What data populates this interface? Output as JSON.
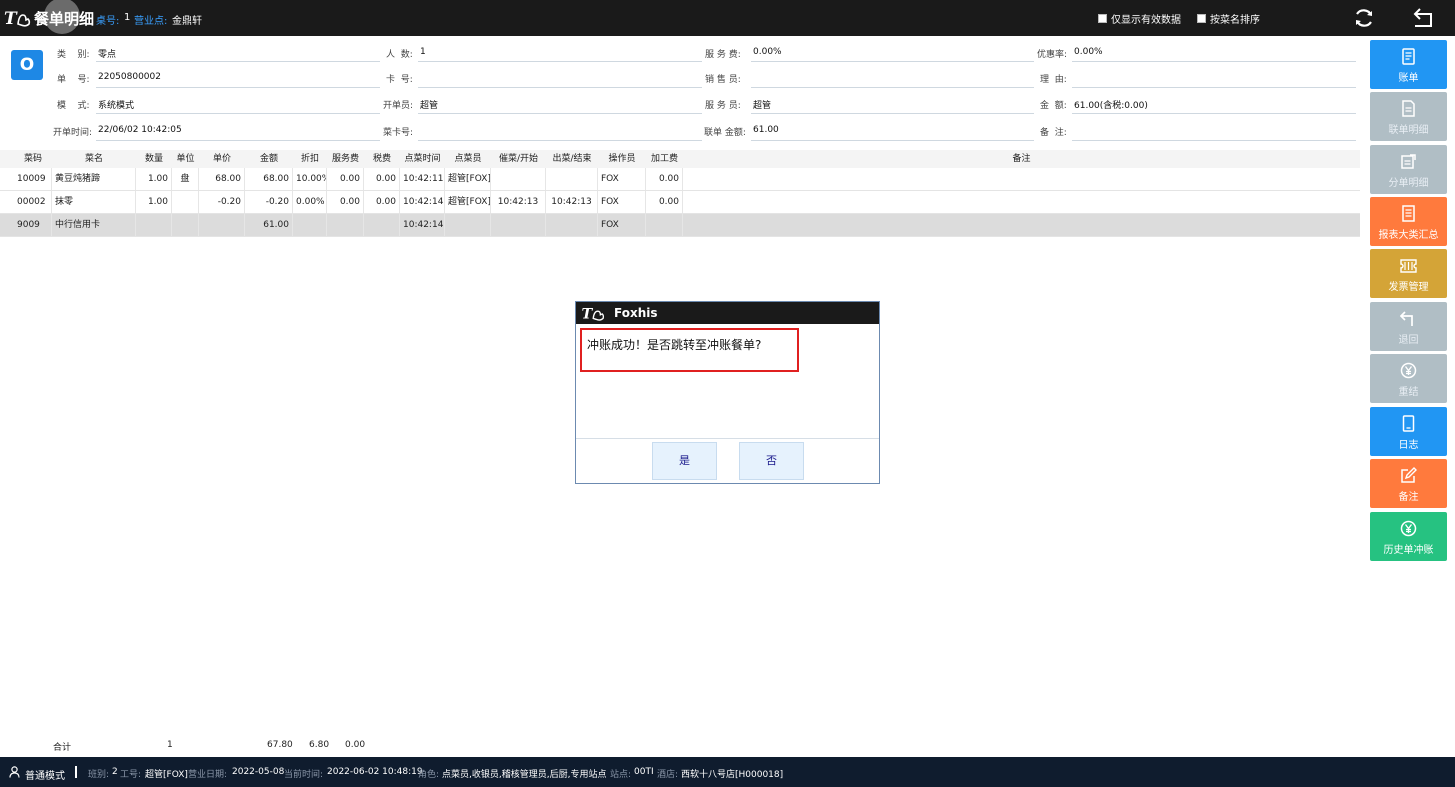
{
  "header": {
    "title": "餐单明细",
    "table_label": "桌号:",
    "table_value": "1",
    "outlet_label": "营业点:",
    "outlet_value": "金鼎轩",
    "opt_valid_only": "仅显示有效数据",
    "opt_sort_by_name": "按菜名排序"
  },
  "info": {
    "avatar": "O",
    "type_label": "类    别:",
    "type_value": "零点",
    "bill_label": "单    号:",
    "bill_value": "22050800002",
    "mode_label": "模    式:",
    "mode_value": "系统模式",
    "open_time_label": "开单时间:",
    "open_time_value": "22/06/02 10:42:05",
    "guests_label": "人  数:",
    "guests_value": "1",
    "card_label": "卡  号:",
    "card_value": "",
    "opener_label": "开单员:",
    "opener_value": "超管",
    "dish_card_label": "菜卡号:",
    "dish_card_value": "",
    "service_fee_label": "服 务 费:",
    "service_fee_value": "0.00%",
    "salesperson_label": "销 售 员:",
    "salesperson_value": "",
    "waiter_label": "服 务 员:",
    "waiter_value": "超管",
    "joint_amount_label": "联单 金额:",
    "joint_amount_value": "61.00",
    "discount_rate_label": "优惠率:",
    "discount_rate_value": "0.00%",
    "reason_label": "理  由:",
    "reason_value": "",
    "amount_label": "金  额:",
    "amount_value": "61.00(含税:0.00)",
    "remark_label": "备  注:",
    "remark_value": ""
  },
  "grid": {
    "columns": [
      "菜码",
      "菜名",
      "数量",
      "单位",
      "单价",
      "金额",
      "折扣",
      "服务费",
      "税费",
      "点菜时间",
      "点菜员",
      "催菜/开始",
      "出菜/结束",
      "操作员",
      "加工费",
      "备注"
    ],
    "rows": [
      [
        "10009",
        "黄豆炖猪蹄",
        "1.00",
        "盘",
        "68.00",
        "68.00",
        "10.00%",
        "0.00",
        "0.00",
        "10:42:11",
        "超管[FOX]",
        "",
        "",
        "FOX",
        "0.00",
        ""
      ],
      [
        "00002",
        "抹零",
        "1.00",
        "",
        "-0.20",
        "-0.20",
        "0.00%",
        "0.00",
        "0.00",
        "10:42:14",
        "超管[FOX]",
        "10:42:13",
        "10:42:13",
        "FOX",
        "0.00",
        ""
      ],
      [
        "9009",
        "中行信用卡",
        "",
        "",
        "",
        "61.00",
        "",
        "",
        "",
        "10:42:14",
        "",
        "",
        "",
        "FOX",
        "",
        ""
      ]
    ]
  },
  "totals": {
    "label": "合计",
    "qty": "1",
    "amount": "67.80",
    "discount": "6.80",
    "service": "0.00"
  },
  "sidebar": {
    "items": [
      {
        "label": "账单",
        "icon": "bill-icon",
        "color": "#2196f3"
      },
      {
        "label": "联单明细",
        "icon": "doc-icon",
        "color": "#b0bec5"
      },
      {
        "label": "分单明细",
        "icon": "split-icon",
        "color": "#b0bec5"
      },
      {
        "label": "报表大类汇总",
        "icon": "report-icon",
        "color": "#ff7a3d"
      },
      {
        "label": "发票管理",
        "icon": "invoice-icon",
        "color": "#d4a437"
      },
      {
        "label": "退回",
        "icon": "return-icon",
        "color": "#b0bec5"
      },
      {
        "label": "重结",
        "icon": "yen-icon",
        "color": "#b0bec5"
      },
      {
        "label": "日志",
        "icon": "log-icon",
        "color": "#2196f3"
      },
      {
        "label": "备注",
        "icon": "edit-icon",
        "color": "#ff7a3d"
      },
      {
        "label": "历史单冲账",
        "icon": "yen-icon",
        "color": "#26c281"
      }
    ]
  },
  "dialog": {
    "title": "Foxhis",
    "message": "冲账成功！是否跳转至冲账餐单?",
    "yes": "是",
    "no": "否"
  },
  "status": {
    "mode": "普通模式",
    "shift_label": "班别:",
    "shift_value": "2",
    "emp_label": "工号:",
    "emp_value": "超管[FOX]",
    "bizdate_label": "营业日期:",
    "bizdate_value": "2022-05-08",
    "now_label": "当前时间:",
    "now_value": "2022-06-02 10:48:19",
    "role_label": "角色:",
    "role_value": "点菜员,收银员,稽核管理员,后厨,专用站点",
    "station_label": "站点:",
    "station_value": "00TI",
    "hotel_label": "酒店:",
    "hotel_value": "西软十八号店[H000018]"
  }
}
